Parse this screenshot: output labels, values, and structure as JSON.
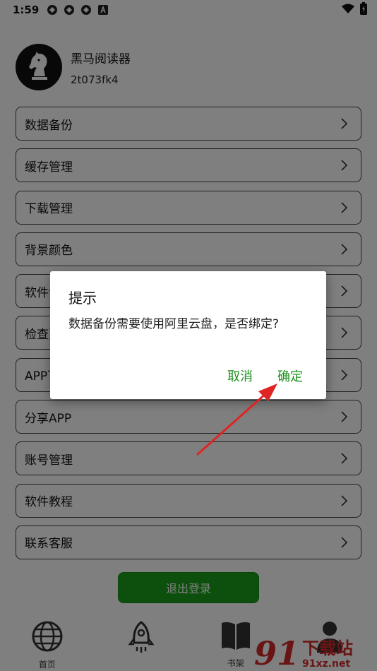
{
  "status_bar": {
    "time": "1:59"
  },
  "profile": {
    "app_name": "黑马阅读器",
    "user_id": "2t073fk4"
  },
  "menu": [
    {
      "label": "数据备份"
    },
    {
      "label": "缓存管理"
    },
    {
      "label": "下载管理"
    },
    {
      "label": "背景颜色"
    },
    {
      "label": "软件设置"
    },
    {
      "label": "检查更新"
    },
    {
      "label": "APP下载"
    },
    {
      "label": "分享APP"
    },
    {
      "label": "账号管理"
    },
    {
      "label": "软件教程"
    },
    {
      "label": "联系客服"
    }
  ],
  "logout_label": "退出登录",
  "tabs": [
    {
      "label": "首页"
    },
    {
      "label": ""
    },
    {
      "label": "书架"
    },
    {
      "label": ""
    }
  ],
  "dialog": {
    "title": "提示",
    "message": "数据备份需要使用阿里云盘，是否绑定?",
    "cancel": "取消",
    "confirm": "确定"
  },
  "watermark": {
    "number": "91",
    "text": "下载站",
    "url": "91xz.net"
  },
  "colors": {
    "accent_green": "#1aa11a",
    "dialog_button": "#1a8f1a",
    "annotation_arrow": "#e02424",
    "watermark": "#d42b2b"
  }
}
